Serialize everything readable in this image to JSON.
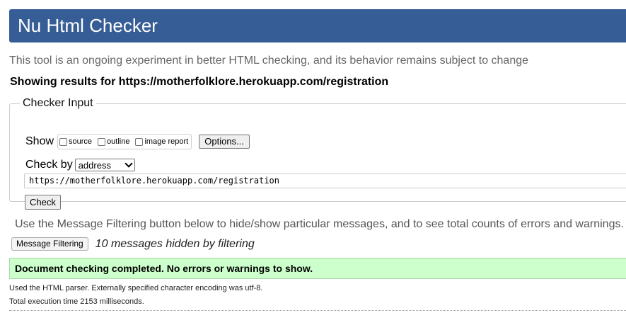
{
  "header": {
    "title": "Nu Html Checker"
  },
  "intro": "This tool is an ongoing experiment in better HTML checking, and its behavior remains subject to change",
  "showing_results": "Showing results for https://motherfolklore.herokuapp.com/registration",
  "checker_input": {
    "legend": "Checker Input",
    "show_label": "Show",
    "show_options": [
      {
        "label": "source",
        "checked": false
      },
      {
        "label": "outline",
        "checked": false
      },
      {
        "label": "image report",
        "checked": false
      }
    ],
    "options_button": "Options...",
    "check_by_label": "Check by",
    "check_by_selected": "address",
    "url_value": "https://motherfolklore.herokuapp.com/registration",
    "check_button": "Check"
  },
  "filtering": {
    "note": "Use the Message Filtering button below to hide/show particular messages, and to see total counts of errors and warnings.",
    "button": "Message Filtering",
    "hidden_count": "10 messages hidden by filtering"
  },
  "result": {
    "success": "Document checking completed. No errors or warnings to show.",
    "parser_note": "Used the HTML parser. Externally specified character encoding was utf-8.",
    "timing": "Total execution time 2153 milliseconds."
  },
  "colors": {
    "header_bg": "#365d95",
    "success_bg": "#ccffcc"
  }
}
